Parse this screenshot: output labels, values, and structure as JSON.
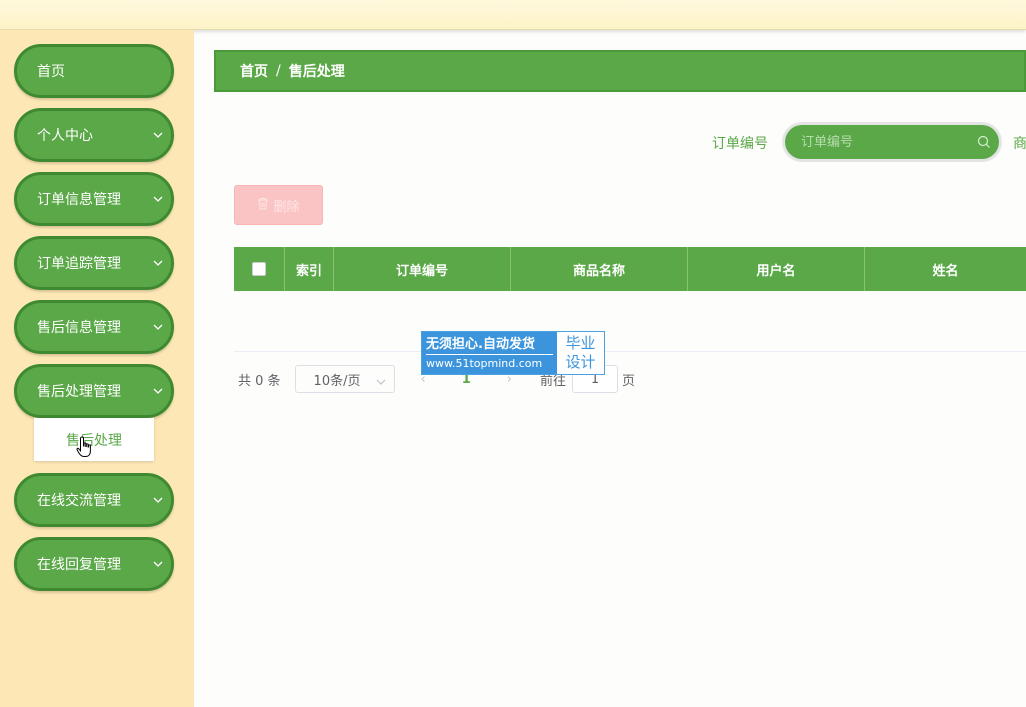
{
  "sidebar": {
    "items": [
      {
        "label": "首页",
        "has_chevron": false
      },
      {
        "label": "个人中心",
        "has_chevron": true
      },
      {
        "label": "订单信息管理",
        "has_chevron": true
      },
      {
        "label": "订单追踪管理",
        "has_chevron": true
      },
      {
        "label": "售后信息管理",
        "has_chevron": true
      },
      {
        "label": "售后处理管理",
        "has_chevron": true
      },
      {
        "label": "在线交流管理",
        "has_chevron": true
      },
      {
        "label": "在线回复管理",
        "has_chevron": true
      }
    ],
    "submenu": {
      "label": "售后处理"
    }
  },
  "breadcrumb": {
    "home": "首页",
    "separator": "/",
    "current": "售后处理"
  },
  "search": {
    "label": "订单编号",
    "placeholder": "订单编号",
    "next_label": "商"
  },
  "toolbar": {
    "delete_label": "删除"
  },
  "table": {
    "columns": [
      "索引",
      "订单编号",
      "商品名称",
      "用户名",
      "姓名"
    ],
    "rows": []
  },
  "pagination": {
    "total_text": "共 0 条",
    "page_size": "10条/页",
    "current_page": "1",
    "goto_label": "前往",
    "goto_value": "1",
    "unit": "页"
  },
  "watermark": {
    "line1": "无须担心.自动发货",
    "line2": "www.51topmind.com",
    "right1": "毕业",
    "right2": "设计"
  },
  "colors": {
    "primary": "#5aa847",
    "sidebar_bg": "#fde8b5",
    "danger_light": "#fbc4c4"
  },
  "icons": {
    "chevron": "chevron-down-icon",
    "search": "search-icon",
    "delete": "trash-icon"
  }
}
